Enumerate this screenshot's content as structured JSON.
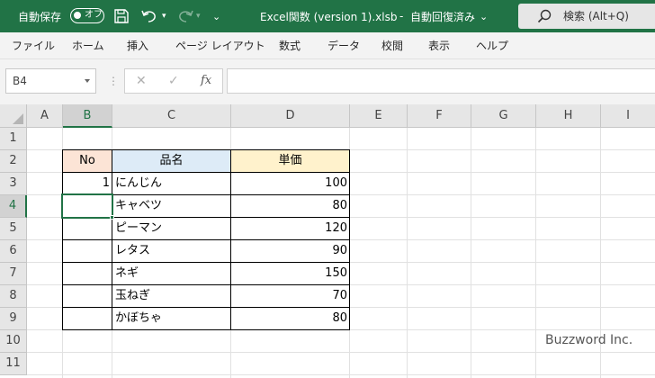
{
  "titlebar": {
    "autosave_label": "自動保存",
    "autosave_toggle_text": "オフ",
    "filename": "Excel関数 (version 1).xlsb",
    "separator": "-",
    "save_status": "自動回復済み",
    "save_status_caret": "⌄",
    "more_caret": "⌄",
    "search_placeholder": "検索 (Alt+Q)",
    "colors": {
      "bar": "#217346",
      "search_bg": "#e6e6e6"
    }
  },
  "ribbon_tabs": [
    "ファイル",
    "ホーム",
    "挿入",
    "ページ レイアウト",
    "数式",
    "データ",
    "校閲",
    "表示",
    "ヘルプ"
  ],
  "formula_bar": {
    "name_box": "B4",
    "dots": "⋮",
    "cancel_glyph": "✕",
    "enter_glyph": "✓",
    "fx_label": "fx",
    "formula": ""
  },
  "sheet": {
    "columns": [
      "A",
      "B",
      "C",
      "D",
      "E",
      "F",
      "G",
      "H",
      "I"
    ],
    "rows": [
      "1",
      "2",
      "3",
      "4",
      "5",
      "6",
      "7",
      "8",
      "9",
      "10",
      "11"
    ],
    "selected_cell": "B4",
    "table": {
      "headers": [
        "No",
        "品名",
        "単価"
      ],
      "header_colors": [
        "#fce4d6",
        "#ddebf7",
        "#fff2cc"
      ],
      "rows": [
        {
          "no": "1",
          "name": "にんじん",
          "price": "100"
        },
        {
          "no": "",
          "name": "キャベツ",
          "price": "80"
        },
        {
          "no": "",
          "name": "ピーマン",
          "price": "120"
        },
        {
          "no": "",
          "name": "レタス",
          "price": "90"
        },
        {
          "no": "",
          "name": "ネギ",
          "price": "150"
        },
        {
          "no": "",
          "name": "玉ねぎ",
          "price": "70"
        },
        {
          "no": "",
          "name": "かぼちゃ",
          "price": "80"
        }
      ]
    }
  },
  "watermark": "Buzzword Inc."
}
